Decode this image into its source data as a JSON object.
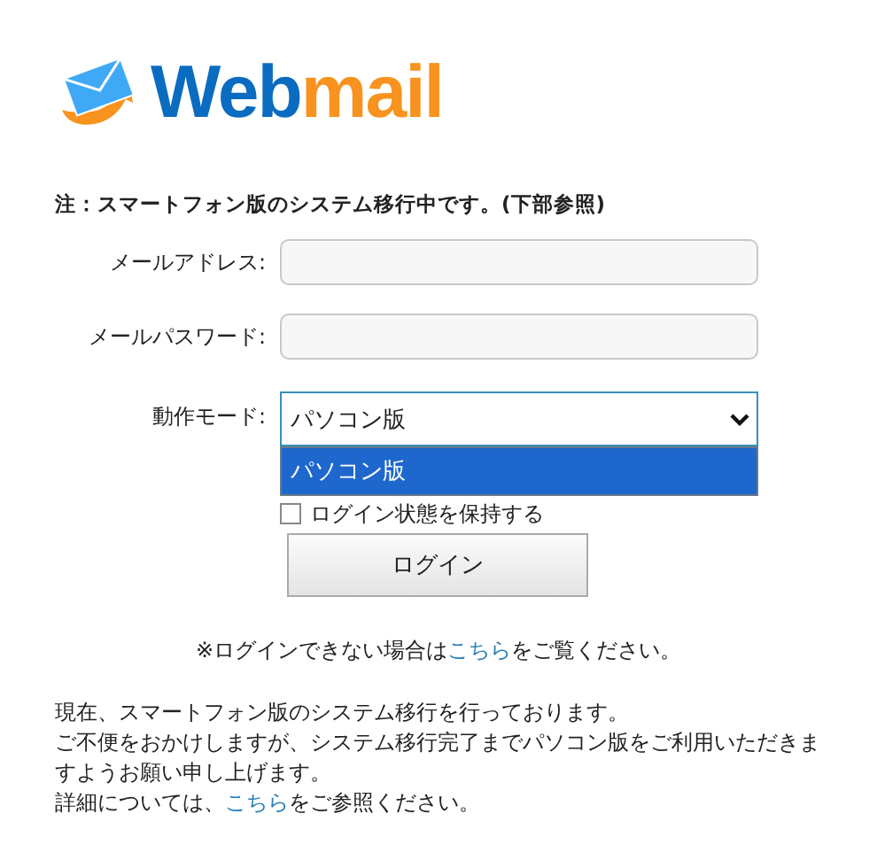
{
  "logo": {
    "text_primary": "Web",
    "text_accent": "mail"
  },
  "notice": "注：スマートフォン版のシステム移行中です。(下部参照)",
  "fields": [
    {
      "kind": "text",
      "label": "メールアドレス:"
    },
    {
      "kind": "text",
      "label": "メールパスワード:"
    },
    {
      "kind": "select",
      "label": "動作モード:",
      "value": "パソコン版",
      "expanded": true,
      "options": [
        {
          "label": "パソコン版",
          "selected": true
        }
      ]
    }
  ],
  "remember": {
    "label": "ログイン状態を保持する",
    "checked": false
  },
  "login_button": "ログイン",
  "help": {
    "before": "※ログインできない場合は",
    "link": "こちら",
    "after": "をご覧ください。"
  },
  "message": {
    "lines": [
      "現在、スマートフォン版のシステム移行を行っております。",
      "ご不便をおかけしますが、システム移行完了までパソコン版をご利用いただきますようお願い申し上げます。"
    ],
    "detail_before": "詳細については、",
    "detail_link": "こちら",
    "detail_after": "をご参照ください。"
  }
}
